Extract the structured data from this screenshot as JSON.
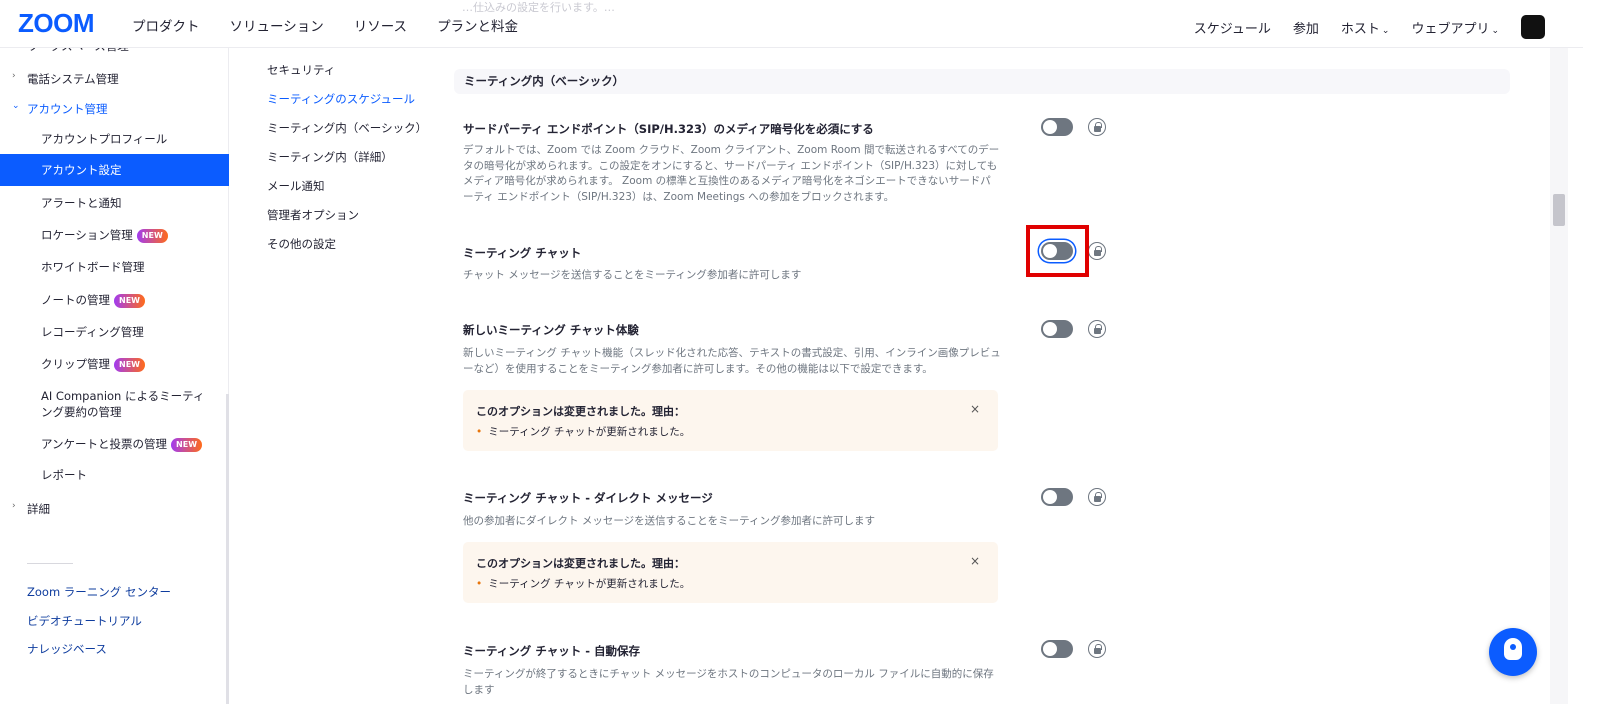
{
  "topbar": {
    "logo": "ZOOM",
    "nav": [
      "プロダクト",
      "ソリューション",
      "リソース",
      "プランと料金"
    ],
    "right": {
      "schedule": "スケジュール",
      "join": "参加",
      "host": "ホスト",
      "webapp": "ウェブアプリ"
    },
    "faded_text": "…仕込みの設定を行います。…"
  },
  "sidebar": {
    "cut_top": "ワークスペース管理",
    "phone": "電話システム管理",
    "account_mgmt": "アカウント管理",
    "items": [
      {
        "label": "アカウントプロフィール",
        "new": false
      },
      {
        "label": "アカウント設定",
        "new": false
      },
      {
        "label": "アラートと通知",
        "new": false
      },
      {
        "label": "ロケーション管理",
        "new": true
      },
      {
        "label": "ホワイトボード管理",
        "new": false
      },
      {
        "label": "ノートの管理",
        "new": true
      },
      {
        "label": "レコーディング管理",
        "new": false
      },
      {
        "label": "クリップ管理",
        "new": true
      },
      {
        "label": "AI Companion によるミーティング要約の管理",
        "new": false
      },
      {
        "label": "アンケートと投票の管理",
        "new": true
      },
      {
        "label": "レポート",
        "new": false
      }
    ],
    "new_badge": "NEW",
    "details": "詳細",
    "links": [
      "Zoom ラーニング センター",
      "ビデオチュートリアル",
      "ナレッジベース"
    ]
  },
  "subnav": [
    "セキュリティ",
    "ミーティングのスケジュール",
    "ミーティング内（ベーシック）",
    "ミーティング内（詳細）",
    "メール通知",
    "管理者オプション",
    "その他の設定"
  ],
  "section_header": "ミーティング内（ベーシック）",
  "settings": [
    {
      "title": "サードパーティ エンドポイント（SIP/H.323）のメディア暗号化を必須にする",
      "desc": "デフォルトでは、Zoom では Zoom クラウド、Zoom クライアント、Zoom Room 間で転送されるすべてのデータの暗号化が求められます。この設定をオンにすると、サードパーティ エンドポイント（SIP/H.323）に対してもメディア暗号化が求められます。 Zoom の標準と互換性のあるメディア暗号化をネゴシエートできないサードパーティ エンドポイント（SIP/H.323）は、Zoom Meetings への参加をブロックされます。",
      "enabled": false
    },
    {
      "title": "ミーティング チャット",
      "desc": "チャット メッセージを送信することをミーティング参加者に許可します",
      "enabled": false
    },
    {
      "title": "新しいミーティング チャット体験",
      "desc": "新しいミーティング チャット機能（スレッド化された応答、テキストの書式設定、引用、インライン画像プレビューなど）を使用することをミーティング参加者に許可します。その他の機能は以下で設定できます。",
      "enabled": false
    },
    {
      "title": "ミーティング チャット - ダイレクト メッセージ",
      "desc": "他の参加者にダイレクト メッセージを送信することをミーティング参加者に許可します",
      "enabled": false
    },
    {
      "title": "ミーティング チャット - 自動保存",
      "desc": "ミーティングが終了するときにチャット メッセージをホストのコンピュータのローカル ファイルに自動的に保存します",
      "enabled": false
    }
  ],
  "notice": {
    "title": "このオプションは変更されました。理由：",
    "item": "ミーティング チャットが更新されました。",
    "close": "×"
  },
  "colors": {
    "accent": "#0b5cff",
    "highlight": "#e00000",
    "notice_bg": "#fdf6ee"
  }
}
